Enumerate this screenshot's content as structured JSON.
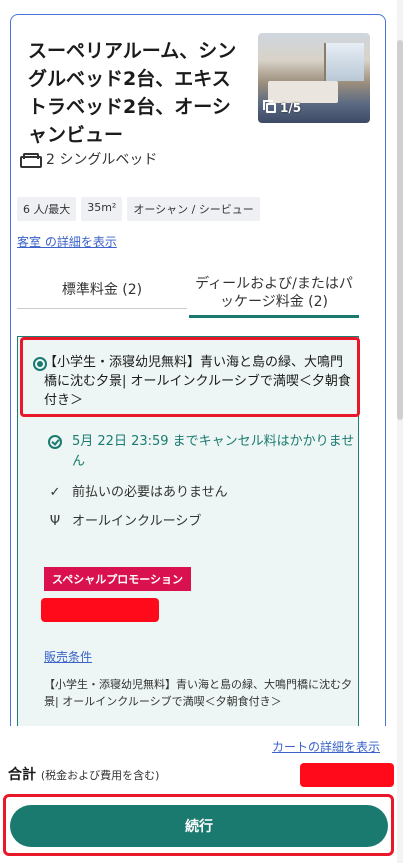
{
  "room": {
    "title": "スーペリアルーム、シングルベッド2台、エキストラベッド2台、オーシャンビュー",
    "photo_count": "1/5",
    "beds": "2 シングルベッド",
    "chips": [
      "6 人/最大",
      "35m²",
      "オーシャン / シービュー"
    ],
    "detail_link": "客室 の詳細を表示"
  },
  "tabs": [
    {
      "label": "標準料金 (2)"
    },
    {
      "label": "ディールおよび/またはパッケージ料金 (2)"
    }
  ],
  "package": {
    "title": "【小学生・添寝幼児無料】青い海と島の緑、大鳴門橋に沈む夕景| オールインクルーシブで満喫＜夕朝食付き＞",
    "cancel": "5月 22日 23:59 までキャンセル料はかかりません",
    "prepay": "前払いの必要はありません",
    "meal": "オールインクルーシブ",
    "promo": "スペシャルプロモーション",
    "sales_link": "販売条件",
    "sales_desc": "【小学生・添寝幼児無料】青い海と島の緑、大鳴門橋に沈む夕景| オールインクルーシブで満喫＜夕朝食付き＞"
  },
  "footer": {
    "cart_link": "カートの詳細を表示",
    "total_label": "合計",
    "total_note": "(税金および費用を含む)",
    "continue_label": "続行"
  },
  "icons": {
    "bed": "bed-icon",
    "photos": "photo-stack-icon",
    "radio": "radio-selected-icon",
    "cancel": "check-circle-icon",
    "prepay": "check-icon",
    "meal": "fork-knife-icon"
  },
  "colors": {
    "accent": "#1a7a70",
    "link": "#3a62c8",
    "promo": "#d9124f",
    "highlight": "#e8182a"
  }
}
